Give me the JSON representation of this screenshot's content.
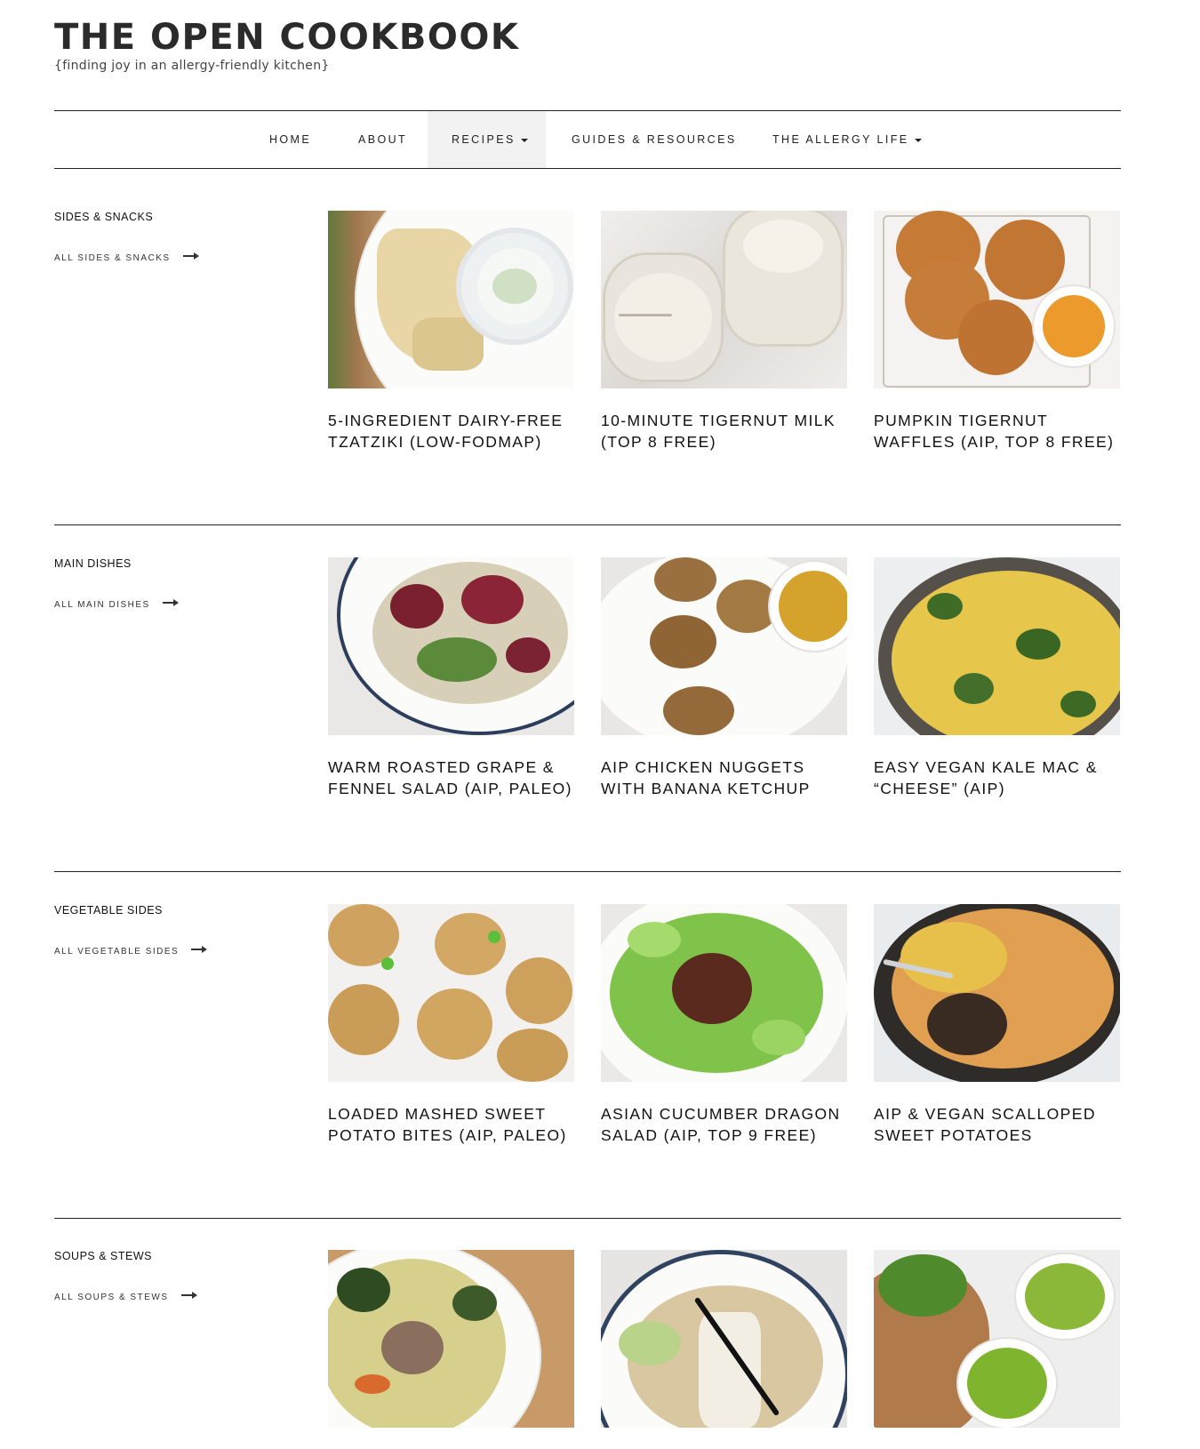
{
  "site": {
    "title": "THE OPEN COOKBOOK",
    "tagline": "{finding joy in an allergy-friendly kitchen}"
  },
  "nav": {
    "items": [
      {
        "label": "HOME"
      },
      {
        "label": "ABOUT"
      },
      {
        "label": "RECIPES",
        "active": true,
        "dropdown": true
      },
      {
        "label": "GUIDES & RESOURCES"
      },
      {
        "label": "THE ALLERGY LIFE",
        "dropdown": true
      }
    ]
  },
  "sections": [
    {
      "title": "SIDES & SNACKS",
      "link": "ALL SIDES & SNACKS",
      "cards": [
        {
          "title": "5-INGREDIENT DAIRY-FREE TZATZIKI (LOW-FODMAP)"
        },
        {
          "title": "10-MINUTE TIGERNUT MILK (TOP 8 FREE)"
        },
        {
          "title": "PUMPKIN TIGERNUT WAFFLES (AIP, TOP 8 FREE)"
        }
      ]
    },
    {
      "title": "MAIN DISHES",
      "link": "ALL MAIN DISHES",
      "cards": [
        {
          "title": "WARM ROASTED GRAPE & FENNEL SALAD (AIP, PALEO)"
        },
        {
          "title": "AIP CHICKEN NUGGETS WITH BANANA KETCHUP"
        },
        {
          "title": "EASY VEGAN KALE MAC & “CHEESE” (AIP)"
        }
      ]
    },
    {
      "title": "VEGETABLE SIDES",
      "link": "ALL VEGETABLE SIDES",
      "cards": [
        {
          "title": "LOADED MASHED SWEET POTATO BITES (AIP, PALEO)"
        },
        {
          "title": "ASIAN CUCUMBER DRAGON SALAD (AIP, TOP 9 FREE)"
        },
        {
          "title": "AIP & VEGAN SCALLOPED SWEET POTATOES"
        }
      ]
    },
    {
      "title": "SOUPS & STEWS",
      "link": "ALL SOUPS & STEWS",
      "cards": [
        {
          "title": ""
        },
        {
          "title": ""
        },
        {
          "title": ""
        }
      ]
    }
  ],
  "icons": {
    "arrow": "arrow-right-icon",
    "caret": "caret-down-icon"
  }
}
